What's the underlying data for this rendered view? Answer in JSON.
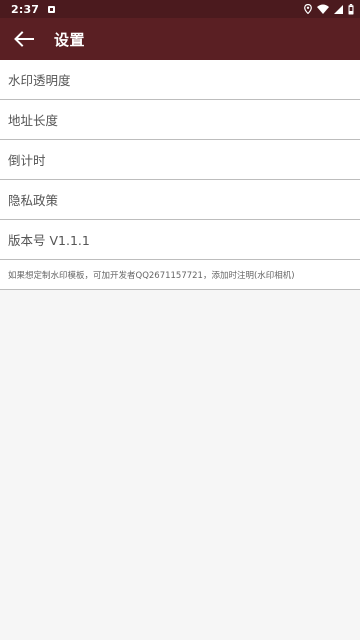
{
  "status_bar": {
    "time": "2:37",
    "icons": [
      "notification-icon",
      "location-icon",
      "wifi-icon",
      "signal-icon",
      "battery-icon"
    ]
  },
  "app_bar": {
    "title": "设置",
    "back_icon": "arrow-back-icon"
  },
  "settings": {
    "items": [
      {
        "label": "水印透明度"
      },
      {
        "label": "地址长度"
      },
      {
        "label": "倒计时"
      },
      {
        "label": "隐私政策"
      },
      {
        "label": "版本号 V1.1.1"
      }
    ],
    "note": "如果想定制水印模板，可加开发者QQ2671157721，添加时注明(水印相机)"
  },
  "colors": {
    "status_bar": "#4b1a1e",
    "app_bar": "#5a1f23",
    "background": "#f6f6f6",
    "divider": "#bdbdbd"
  }
}
